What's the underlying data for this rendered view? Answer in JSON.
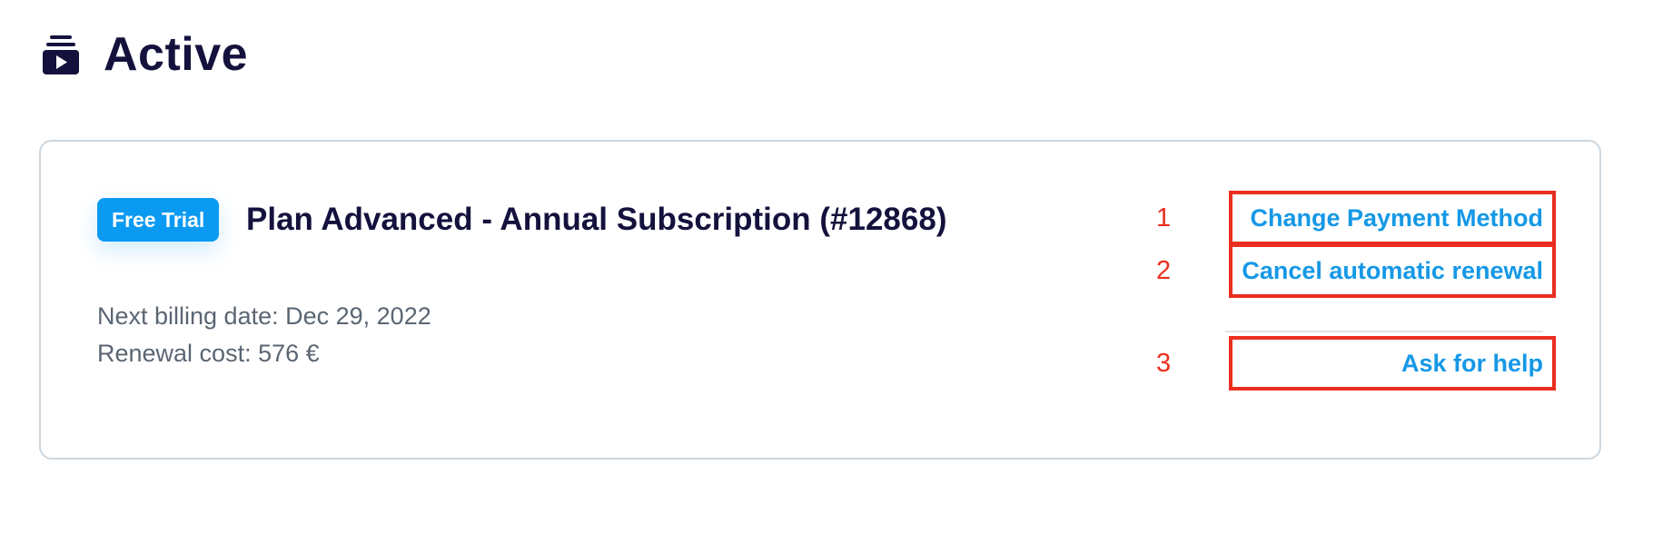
{
  "section": {
    "icon": "subscriptions-icon",
    "title": "Active"
  },
  "subscription": {
    "badge": "Free Trial",
    "title": "Plan Advanced - Annual Subscription (#12868)",
    "next_billing": "Next billing date: Dec 29, 2022",
    "renewal_cost": "Renewal cost: 576 €"
  },
  "actions": [
    {
      "marker": "1",
      "label": "Change Payment Method"
    },
    {
      "marker": "2",
      "label": "Cancel automatic renewal"
    },
    {
      "marker": "3",
      "label": "Ask for help"
    }
  ],
  "colors": {
    "heading": "#14123d",
    "accent": "#0b9af2",
    "link": "#1598e6",
    "annotation": "#ea2e1f",
    "muted_text": "#5b6673",
    "card_border": "#cdd7df"
  }
}
